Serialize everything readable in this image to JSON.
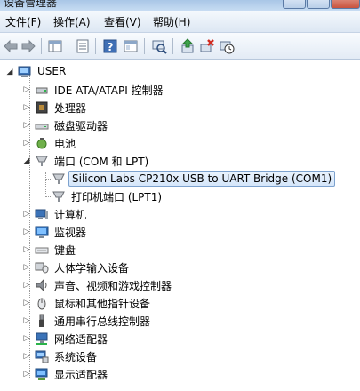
{
  "window": {
    "title": "设备管理器"
  },
  "menu": [
    {
      "label": "文件(F)"
    },
    {
      "label": "操作(A)"
    },
    {
      "label": "查看(V)"
    },
    {
      "label": "帮助(H)"
    }
  ],
  "toolbar": {
    "icons": [
      "back-icon",
      "forward-icon",
      "show-hide-console-tree-icon",
      "properties-icon",
      "help-icon",
      "view-icon",
      "scan-hardware-icon",
      "update-driver-icon",
      "uninstall-icon",
      "disable-icon"
    ]
  },
  "tree": {
    "root": {
      "label": "USER",
      "icon": "computer-icon"
    },
    "items": [
      {
        "label": "IDE ATA/ATAPI 控制器",
        "icon": "ide-controller-icon"
      },
      {
        "label": "处理器",
        "icon": "processor-icon"
      },
      {
        "label": "磁盘驱动器",
        "icon": "disk-drive-icon"
      },
      {
        "label": "电池",
        "icon": "battery-icon"
      },
      {
        "label": "端口 (COM 和 LPT)",
        "icon": "port-icon",
        "children": [
          {
            "label": "Silicon Labs CP210x USB to UART Bridge (COM1)",
            "icon": "port-device-icon"
          },
          {
            "label": "打印机端口 (LPT1)",
            "icon": "printer-port-icon"
          }
        ]
      },
      {
        "label": "计算机",
        "icon": "computer-category-icon"
      },
      {
        "label": "监视器",
        "icon": "monitor-icon"
      },
      {
        "label": "键盘",
        "icon": "keyboard-icon"
      },
      {
        "label": "人体学输入设备",
        "icon": "hid-icon"
      },
      {
        "label": "声音、视频和游戏控制器",
        "icon": "sound-icon"
      },
      {
        "label": "鼠标和其他指针设备",
        "icon": "mouse-icon"
      },
      {
        "label": "通用串行总线控制器",
        "icon": "usb-icon"
      },
      {
        "label": "网络适配器",
        "icon": "network-adapter-icon"
      },
      {
        "label": "系统设备",
        "icon": "system-device-icon"
      },
      {
        "label": "显示适配器",
        "icon": "display-adapter-icon"
      }
    ]
  }
}
